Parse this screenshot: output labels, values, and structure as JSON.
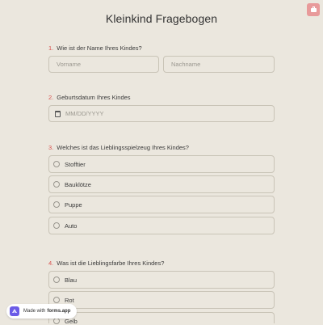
{
  "form": {
    "title": "Kleinkind Fragebogen"
  },
  "questions": [
    {
      "number": "1.",
      "label": "Wie ist der Name Ihres Kindes?",
      "first_name_placeholder": "Vorname",
      "last_name_placeholder": "Nachname"
    },
    {
      "number": "2.",
      "label": "Geburtsdatum Ihres Kindes",
      "date_placeholder": "MM/DD/YYYY"
    },
    {
      "number": "3.",
      "label": "Welches ist das Lieblingsspielzeug Ihres Kindes?",
      "options": [
        "Stofftier",
        "Bauklötze",
        "Puppe",
        "Auto"
      ]
    },
    {
      "number": "4.",
      "label": "Was ist die Lieblingsfarbe Ihres Kindes?",
      "options": [
        "Blau",
        "Rot",
        "Gelb"
      ]
    }
  ],
  "badge": {
    "prefix": "Made with",
    "brand": "forms.app"
  },
  "colors": {
    "background": "#ebe7de",
    "accent": "#d9534f",
    "corner_button": "#e89a9a",
    "border": "#c9c4b7"
  }
}
